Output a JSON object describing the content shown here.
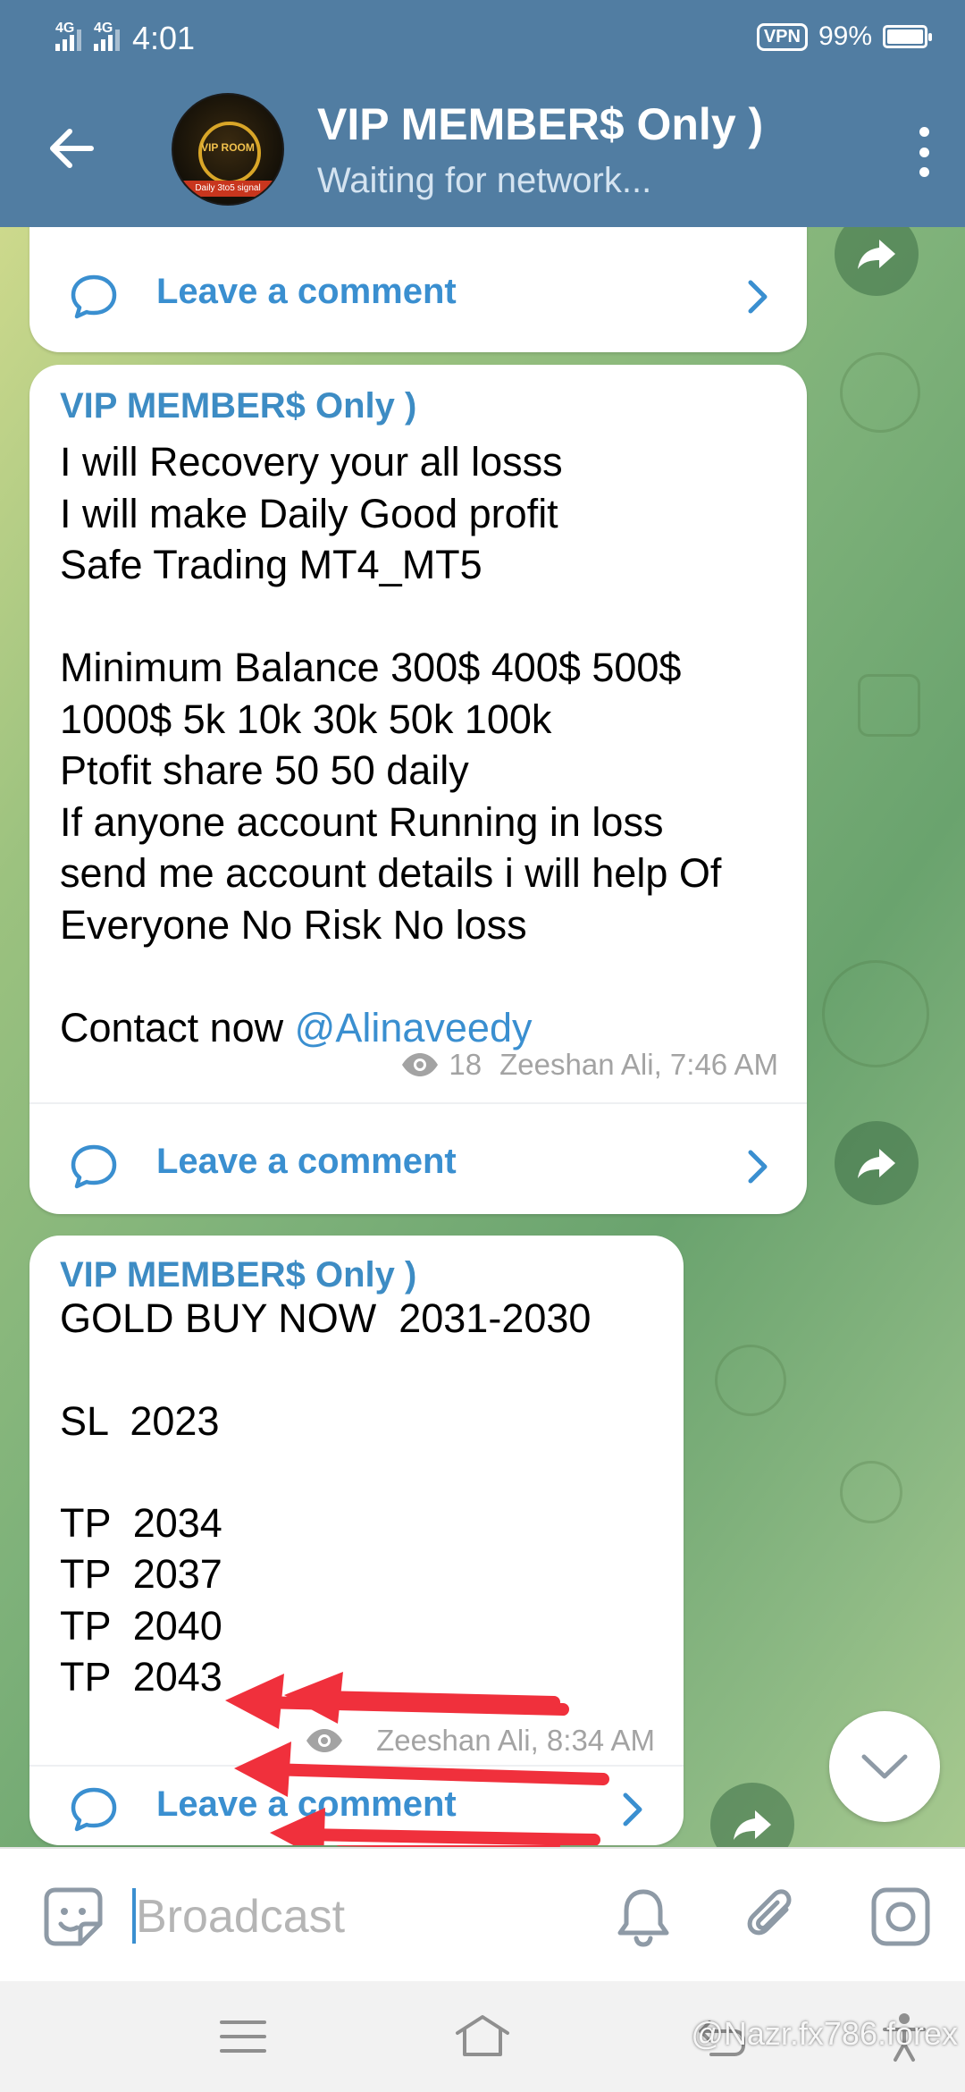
{
  "status_bar": {
    "signal1": "4G",
    "signal2": "4G",
    "time": "4:01",
    "vpn": "VPN",
    "battery": "99%"
  },
  "header": {
    "title": "VIP MEMBER$ Only )",
    "subtitle": "Waiting for network...",
    "avatar_text": "VIP ROOM",
    "avatar_strip": "Daily 3to5 signal"
  },
  "messages": [
    {
      "comment_label": "Leave a comment"
    },
    {
      "sender": "VIP MEMBER$ Only )",
      "text": "I will Recovery your all losss\nI will make Daily Good profit\nSafe Trading MT4_MT5\n\nMinimum Balance 300$ 400$ 500$\n1000$ 5k 10k 30k 50k 100k\nPtofit share 50 50 daily\nIf anyone account Running in loss\nsend me account details i will help Of\nEveryone No Risk No loss\n\n",
      "contact_prefix": "Contact now ",
      "mention": "@Alinaveedy",
      "views": "18",
      "author_time": "Zeeshan Ali, 7:46 AM",
      "comment_label": "Leave a comment"
    },
    {
      "sender": "VIP MEMBER$ Only )",
      "text": "GOLD BUY NOW  2031-2030\n\nSL  2023\n\nTP  2034\nTP  2037\nTP  2040\nTP  2043",
      "author_time": "Zeeshan Ali, 8:34 AM",
      "comment_label": "Leave a comment"
    }
  ],
  "input": {
    "placeholder": "Broadcast"
  },
  "watermark": "@Nazr.fx786.forex",
  "colors": {
    "header": "#517da2",
    "link": "#3a8fd0",
    "sender": "#3d8cc4",
    "arrow": "#f0303c"
  }
}
